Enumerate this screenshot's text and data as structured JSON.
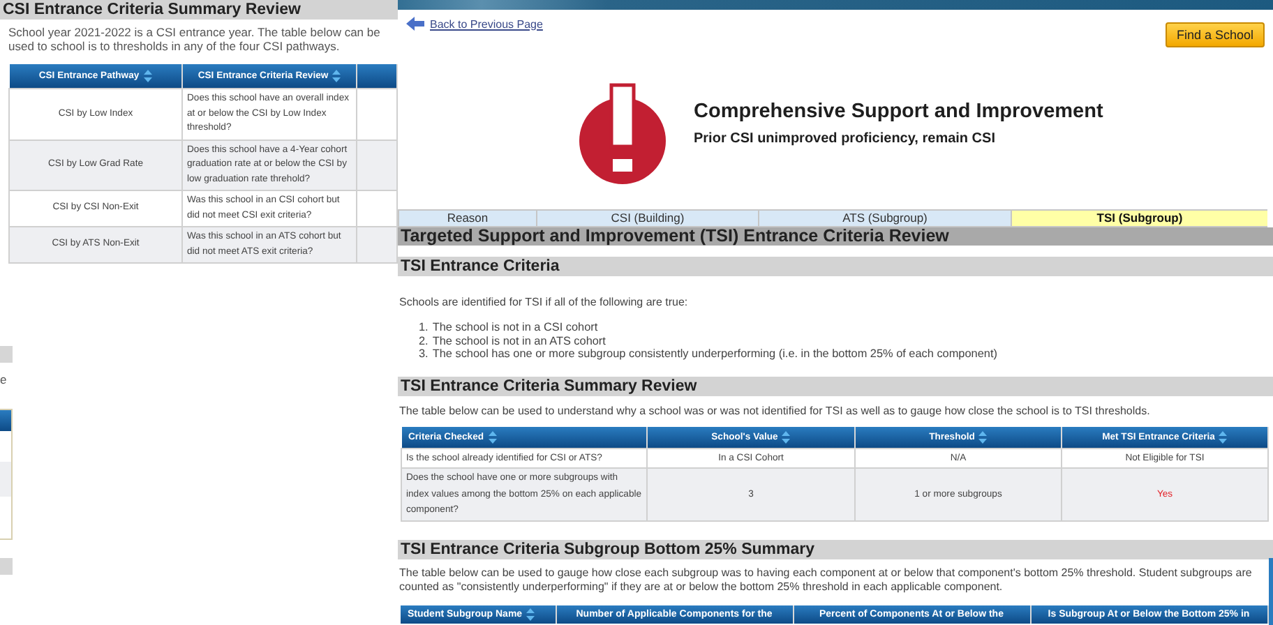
{
  "left_page": {
    "heading": "CSI Entrance Criteria Summary Review",
    "intro": "School year 2021-2022 is a CSI entrance year. The table below can be used to school is to thresholds in any of the four CSI pathways.",
    "table": {
      "columns": [
        {
          "label": "CSI Entrance Pathway",
          "sortable": true
        },
        {
          "label": "CSI Entrance Criteria Review",
          "sortable": true
        }
      ],
      "rows": [
        {
          "cells": [
            "CSI by Low Index",
            "Does this school have an overall index at or below the CSI by Low Index threshold?"
          ]
        },
        {
          "cells": [
            "CSI by Low Grad Rate",
            "Does this school have a 4-Year cohort graduation rate at or below the CSI by low graduation rate threhold?"
          ]
        },
        {
          "cells": [
            "CSI by CSI Non-Exit",
            "Was this school in an CSI cohort but did not meet CSI exit criteria?"
          ]
        },
        {
          "cells": [
            "CSI by ATS Non-Exit",
            "Was this school in an ATS cohort but did not meet ATS exit criteria?"
          ]
        }
      ]
    },
    "fragment_text": "e"
  },
  "main_page": {
    "back_link": "Back to Previous Page",
    "find_button": "Find a School",
    "title": "Comprehensive Support and Improvement",
    "subtitle": "Prior CSI unimproved proficiency, remain CSI",
    "tabs": [
      {
        "label": "Reason",
        "selected": false
      },
      {
        "label": "CSI (Building)",
        "selected": false
      },
      {
        "label": "ATS (Subgroup)",
        "selected": false
      },
      {
        "label": "TSI (Subgroup)",
        "selected": true
      }
    ],
    "review_heading": "Targeted Support and Improvement (TSI) Entrance Criteria Review",
    "criteria": {
      "heading": "TSI Entrance Criteria",
      "intro": "Schools are identified for TSI if all of the following are true:",
      "items": [
        {
          "marker": "1.",
          "text": "The school is not in a CSI cohort"
        },
        {
          "marker": "2.",
          "text": "The school is not in an ATS cohort"
        },
        {
          "marker": "3.",
          "text": "The school has one or more subgroup consistently underperforming (i.e. in the bottom 25% of each component)"
        }
      ]
    },
    "summary": {
      "heading": "TSI Entrance Criteria Summary Review",
      "intro": "The table below can be used to understand why a school was or was not identified for TSI as well as to gauge how close the school is to TSI thresholds.",
      "table": {
        "columns": [
          {
            "label": "Criteria Checked",
            "sortable": true
          },
          {
            "label": "School's Value",
            "sortable": true
          },
          {
            "label": "Threshold",
            "sortable": true
          },
          {
            "label": "Met TSI Entrance Criteria",
            "sortable": true
          }
        ],
        "rows": [
          {
            "cells": [
              "Is the school already identified for CSI or ATS?",
              "In a CSI Cohort",
              "N/A",
              "Not Eligible for TSI"
            ],
            "result_alert": false
          },
          {
            "cells": [
              "Does the school have one or more subgroups with index values among the bottom 25% on each applicable component?",
              "3",
              "1 or more subgroups",
              "Yes"
            ],
            "result_alert": true
          }
        ]
      }
    },
    "subgroup": {
      "heading": "TSI Entrance Criteria Subgroup Bottom 25% Summary",
      "intro": "The table below can be used to gauge how close each subgroup was to having each component at or below that component's bottom 25% threshold. Student subgroups are counted as \"consistently underperforming\" if they are at or below the bottom 25% threshold in each applicable component.",
      "table": {
        "columns": [
          {
            "label": "Student Subgroup Name",
            "sortable": true
          },
          {
            "label": "Number of Applicable Components for the",
            "sortable": false
          },
          {
            "label": "Percent of Components At or Below the",
            "sortable": false
          },
          {
            "label": "Is Subgroup At or Below the Bottom 25% in",
            "sortable": false
          }
        ]
      }
    }
  }
}
